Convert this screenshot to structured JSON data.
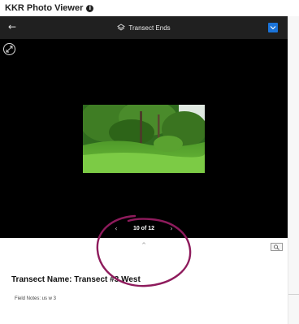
{
  "app": {
    "title": "KKR Photo Viewer",
    "info_icon": "info-icon",
    "info_glyph": "i"
  },
  "header": {
    "back_icon": "arrow-left-icon",
    "back_glyph": "←",
    "layer_icon": "layers-icon",
    "layer_title": "Transect Ends",
    "action_icon": "chevron-down-icon",
    "accent_color": "#1a73d9"
  },
  "viewer": {
    "expand_icon": "expand-icon",
    "background": "#000000",
    "pager": {
      "prev_glyph": "‹",
      "label": "10 of 12",
      "next_glyph": "›"
    }
  },
  "toolbar": {
    "collapse_glyph": "^",
    "zoom_icon": "zoom-icon"
  },
  "details": {
    "transect_name": "Transect Name: Transect #3 West",
    "field_notes": "Field Notes: us w 3"
  },
  "annotation": {
    "color": "#8e1b5c"
  }
}
